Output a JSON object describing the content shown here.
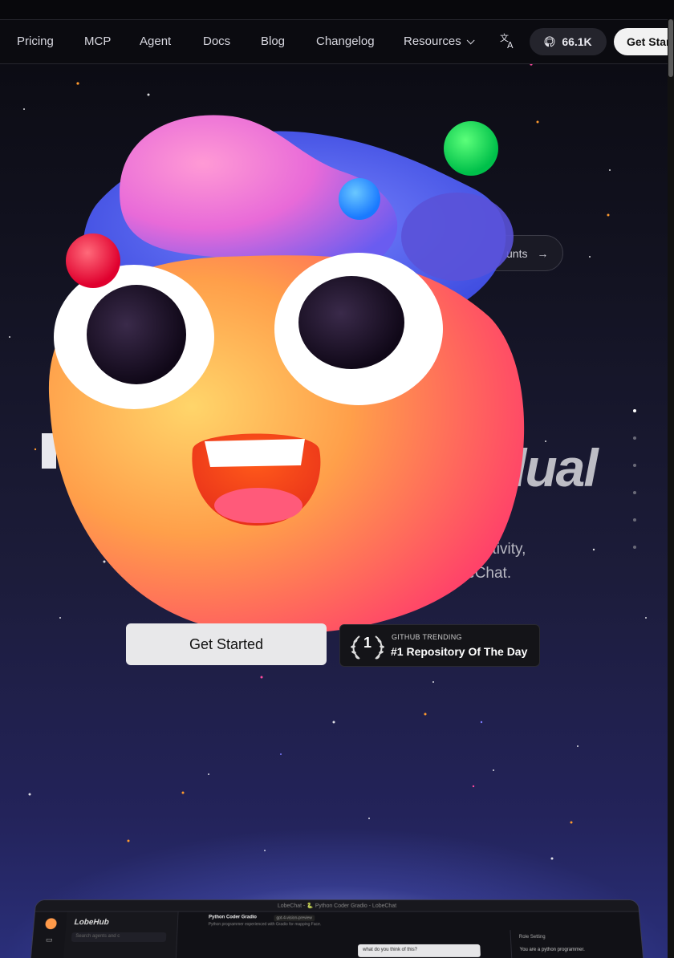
{
  "nav": {
    "links": [
      "Pricing",
      "MCP",
      "Agent",
      "Docs",
      "Blog",
      "Changelog",
      "Resources"
    ],
    "github_stars": "66.1K",
    "cta": "Get Started"
  },
  "hero": {
    "pill_text": "unts",
    "headline_fragment": "dual",
    "subtitle_line1": "ctivity,",
    "subtitle_line2": "obeChat."
  },
  "cta": {
    "primary": "Get Started",
    "trending_rank": "1",
    "trending_label": "GITHUB TRENDING",
    "trending_title": "#1 Repository Of The Day"
  },
  "app_preview": {
    "window_title": "LobeChat - 🐍 Python Coder Gradio - LobeChat",
    "brand": "LobeHub",
    "search_placeholder": "Search agents and c",
    "chat_title": "Python Coder Gradio",
    "model_tag": "gpt-4-vision-preview",
    "chat_subtitle": "Python programmer experienced with Gradio for mapping Face.",
    "message": "what do you think of this?",
    "role_setting": "Role Setting",
    "role_text": "You are a python programmer."
  }
}
